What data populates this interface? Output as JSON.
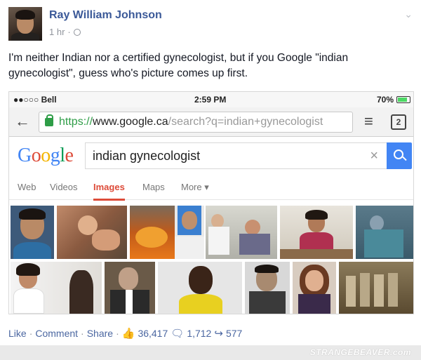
{
  "post": {
    "author": "Ray William Johnson",
    "time": "1 hr",
    "text": "I'm neither Indian nor a certified gynecologist, but if you Google \"indian gynecologist\", guess who's picture comes up first."
  },
  "screenshot": {
    "status_bar": {
      "carrier": "●●○○○ Bell",
      "time": "2:59 PM",
      "battery": "70%"
    },
    "browser": {
      "url_secure": "https://",
      "url_host": "www.google.ca",
      "url_rest": "/search?q=indian+gynecologist",
      "tabs_count": "2"
    },
    "google": {
      "logo": "Google",
      "query": "indian gynecologist",
      "tabs": [
        "Web",
        "Videos",
        "Images",
        "Maps",
        "More ▾"
      ],
      "active_tab": "Images"
    }
  },
  "actions": {
    "like": "Like",
    "comment": "Comment",
    "share": "Share",
    "likes_count": "36,417",
    "comments_count": "1,712",
    "shares_count": "577"
  },
  "watermark": "STRANGEBEAVER.com",
  "colors": {
    "link": "#3b5998",
    "google_blue": "#4285f4",
    "google_red": "#dd4b39",
    "secure_green": "#2e9d47"
  },
  "icons": [
    "globe-icon",
    "chevron-down-icon",
    "back-arrow-icon",
    "lock-icon",
    "menu-icon",
    "tabs-icon",
    "clear-icon",
    "search-icon",
    "like-icon",
    "comment-icon",
    "share-icon"
  ]
}
